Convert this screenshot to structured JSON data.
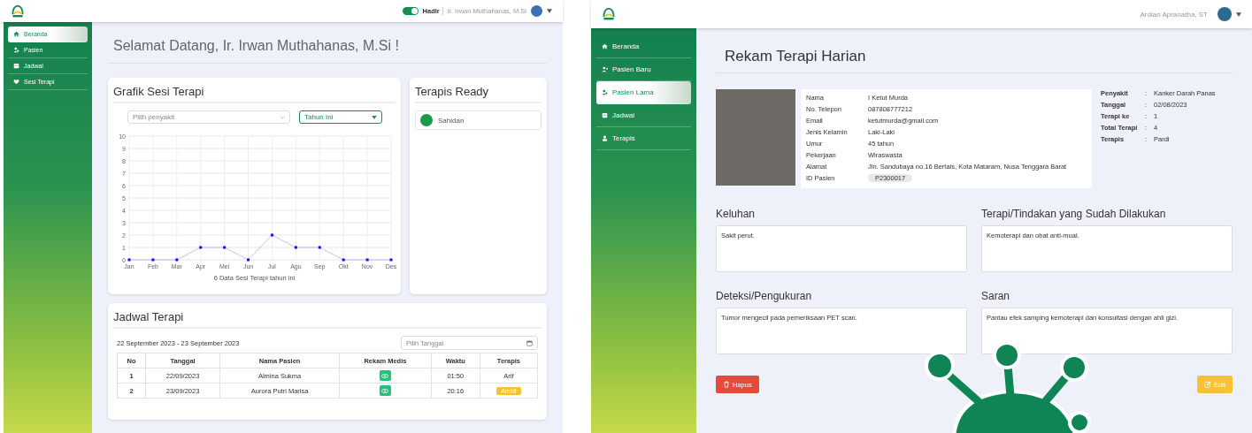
{
  "dashboard": {
    "header": {
      "toggle": {
        "label": "Hadir",
        "on": true
      },
      "user_name": "Ir. Irwan Muthahanas, M.Si"
    },
    "sidebar": {
      "items": [
        {
          "label": "Beranda",
          "selected": true
        },
        {
          "label": "Pasien",
          "selected": false
        },
        {
          "label": "Jadwal",
          "selected": false
        },
        {
          "label": "Sesi Terapi",
          "selected": false
        }
      ]
    },
    "heading": "Selamat Datang, Ir. Irwan Muthahanas, M.Si !",
    "chart_card": {
      "title": "Grafik Sesi Terapi",
      "disease_select": {
        "placeholder": "Pilih penyakit"
      },
      "period_select": {
        "value": "Tahun Ini"
      },
      "chart_data": {
        "type": "line",
        "categories": [
          "Jan",
          "Feb",
          "Mar",
          "Apr",
          "Mei",
          "Jun",
          "Jul",
          "Agu",
          "Sep",
          "Okt",
          "Nov",
          "Des"
        ],
        "series": [
          {
            "color": "#1010ee",
            "marker": true,
            "values": [
              0,
              0,
              0,
              1,
              1,
              0,
              2,
              1,
              1,
              0,
              0,
              0
            ]
          }
        ],
        "grid": true,
        "ylim": [
          0,
          10
        ],
        "yticks": [
          0,
          1,
          2,
          3,
          4,
          5,
          6,
          7,
          8,
          9,
          10
        ],
        "xlabel": "6 Data Sesi Terapi tahun ini"
      }
    },
    "therapists_card": {
      "title": "Terapis Ready",
      "therapists": [
        {
          "name": "Sahidan"
        }
      ]
    },
    "schedule": {
      "title": "Jadwal Terapi",
      "date_range": "22 September 2023 - 23 September 2023",
      "date_field": {
        "placeholder": "Pilih Tanggal"
      },
      "columns": [
        "No",
        "Tanggal",
        "Nama Pasien",
        "Rekam Medis",
        "Waktu",
        "Terapis"
      ],
      "rows": [
        {
          "no": "1",
          "date": "22/09/2023",
          "patient": "Almina Sukma",
          "time": "01:50",
          "therapist": {
            "kind": "name",
            "text": "Arif"
          }
        },
        {
          "no": "2",
          "date": "23/09/2023",
          "patient": "Aurora Putri Marisa",
          "time": "20:16",
          "therapist": {
            "kind": "button",
            "text": "Ambil"
          }
        }
      ]
    }
  },
  "record": {
    "header": {
      "user_name": "Ardian Apranatha, ST"
    },
    "sidebar": {
      "items": [
        {
          "label": "Beranda",
          "selected": false
        },
        {
          "label": "Pasien Baru",
          "selected": false
        },
        {
          "label": "Pasien Lama",
          "selected": true
        },
        {
          "label": "Jadwal",
          "selected": false
        },
        {
          "label": "Terapis",
          "selected": false
        }
      ]
    },
    "heading": "Rekam Terapi Harian",
    "patient": [
      {
        "label": "Nama",
        "value": "I Ketut Murda"
      },
      {
        "label": "No. Telepon",
        "value": "087808777212"
      },
      {
        "label": "Email",
        "value": "ketutmurda@gmail.com"
      },
      {
        "label": "Jenis Kelamin",
        "value": "Laki-Laki"
      },
      {
        "label": "Umur",
        "value": "45 tahun"
      },
      {
        "label": "Pekerjaan",
        "value": "Wiraswasta"
      },
      {
        "label": "Alamat",
        "value": "Jln. Sandubaya no.16 Bertais, Kota Mataram, Nusa Tenggara Barat"
      },
      {
        "label": "ID Pasien",
        "value": "P2300017",
        "kind": "badge"
      }
    ],
    "therapy_info": [
      {
        "label": "Penyakit",
        "value": "Kanker Darah Panas"
      },
      {
        "label": "Tanggal",
        "value": "02/08/2023"
      },
      {
        "label": "Terapi ke",
        "value": "1"
      },
      {
        "label": "Total Terapi",
        "value": "4"
      },
      {
        "label": "Terapis",
        "value": "Pardi"
      }
    ],
    "separator": ":",
    "notes": [
      {
        "label": "Keluhan",
        "value": "Sakit perut."
      },
      {
        "label": "Terapi/Tindakan yang Sudah Dilakukan",
        "value": "Kemoterapi dan obat anti-mual."
      },
      {
        "label": "Deteksi/Pengukuran",
        "value": "Tumor mengecil pada pemeriksaan PET scan."
      },
      {
        "label": "Saran",
        "value": "Pantau efek samping kemoterapi dan konsultasi dengan ahli gizi."
      }
    ],
    "buttons": {
      "delete": "Hapus",
      "edit": "Edit"
    }
  }
}
